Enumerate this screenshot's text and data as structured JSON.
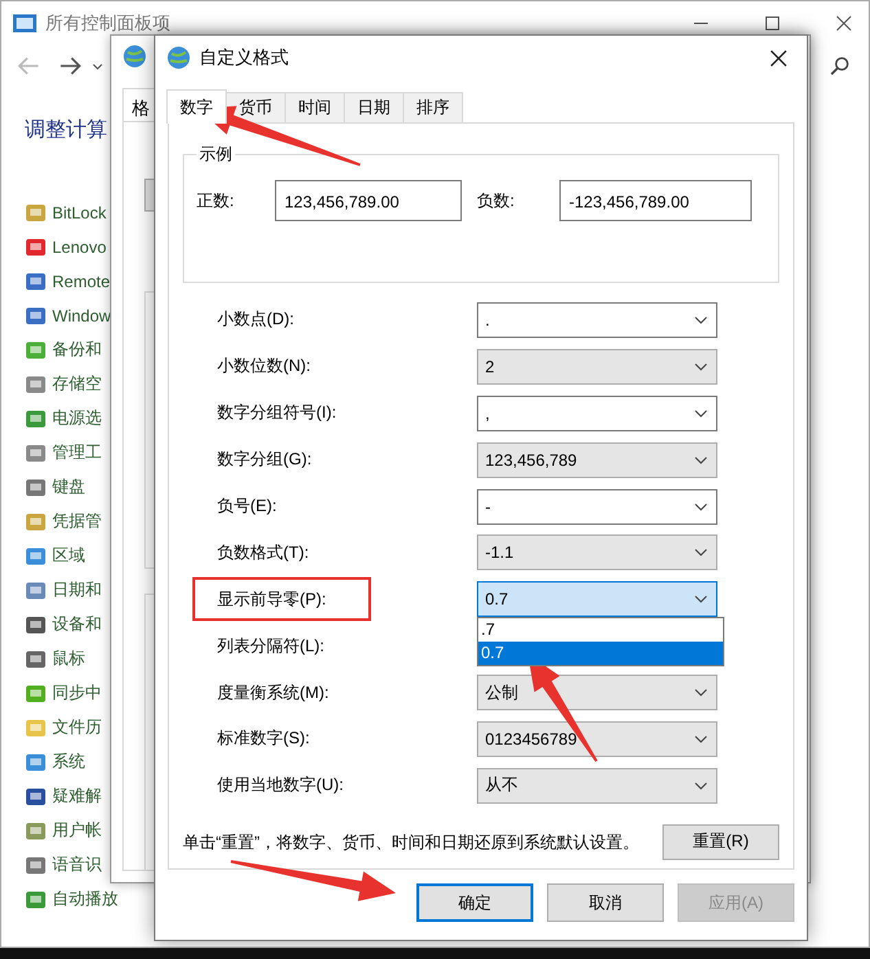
{
  "background_window": {
    "title": "所有控制面板项",
    "heading": "调整计算",
    "items": [
      "BitLock",
      "Lenovo",
      "Remote",
      "Window",
      "备份和",
      "存储空",
      "电源选",
      "管理工",
      "键盘",
      "凭据管",
      "区域",
      "日期和",
      "设备和",
      "鼠标",
      "同步中",
      "文件历",
      "系统",
      "疑难解",
      "用户帐",
      "语音识",
      "自动播放"
    ]
  },
  "region_window": {
    "tab": "格"
  },
  "dialog": {
    "title": "自定义格式",
    "tabs": [
      {
        "label": "数字",
        "selected": true
      },
      {
        "label": "货币",
        "selected": false
      },
      {
        "label": "时间",
        "selected": false
      },
      {
        "label": "日期",
        "selected": false
      },
      {
        "label": "排序",
        "selected": false
      }
    ],
    "example": {
      "title": "示例",
      "positive_label": "正数:",
      "positive": "123,456,789.00",
      "negative_label": "负数:",
      "negative": "-123,456,789.00"
    },
    "settings": [
      {
        "label": "小数点(D):",
        "value": ".",
        "kind": "editable",
        "open": false,
        "highlighted": false
      },
      {
        "label": "小数位数(N):",
        "value": "2",
        "kind": "list",
        "open": false,
        "highlighted": false
      },
      {
        "label": "数字分组符号(I):",
        "value": ",",
        "kind": "editable",
        "open": false,
        "highlighted": false
      },
      {
        "label": "数字分组(G):",
        "value": "123,456,789",
        "kind": "list",
        "open": false,
        "highlighted": false
      },
      {
        "label": "负号(E):",
        "value": "-",
        "kind": "editable",
        "open": false,
        "highlighted": false
      },
      {
        "label": "负数格式(T):",
        "value": "-1.1",
        "kind": "list",
        "open": false,
        "highlighted": false
      },
      {
        "label": "显示前导零(P):",
        "value": "0.7",
        "kind": "list",
        "open": true,
        "highlighted": true,
        "options": [
          {
            "label": ".7",
            "selected": false
          },
          {
            "label": "0.7",
            "selected": true
          }
        ]
      },
      {
        "label": "列表分隔符(L):",
        "highlighted": false
      },
      {
        "label": "度量衡系统(M):",
        "value": "公制",
        "kind": "list",
        "open": false,
        "highlighted": false
      },
      {
        "label": "标准数字(S):",
        "value": "0123456789",
        "kind": "list",
        "open": false,
        "highlighted": false
      },
      {
        "label": "使用当地数字(U):",
        "value": "从不",
        "kind": "list",
        "open": false,
        "highlighted": false
      }
    ],
    "note": "单击“重置”，将数字、货币、时间和日期还原到系统默认设置。",
    "reset_button": "重置(R)",
    "buttons": [
      {
        "label": "确定",
        "focused": true,
        "disabled": false
      },
      {
        "label": "取消",
        "focused": false,
        "disabled": false
      },
      {
        "label": "应用(A)",
        "focused": false,
        "disabled": true
      }
    ]
  }
}
